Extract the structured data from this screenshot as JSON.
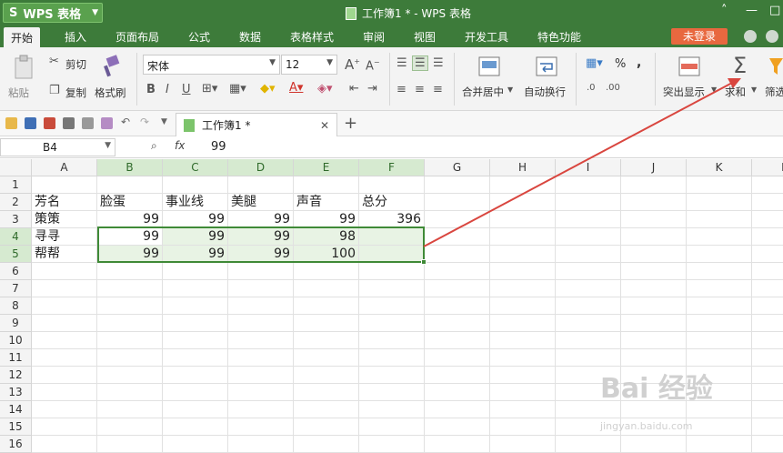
{
  "app": {
    "name": "WPS 表格",
    "logo": "S",
    "doc_title": "工作簿1 * - WPS 表格"
  },
  "menu": {
    "tabs": [
      "开始",
      "插入",
      "页面布局",
      "公式",
      "数据",
      "表格样式",
      "审阅",
      "视图",
      "开发工具",
      "特色功能"
    ],
    "login": "未登录"
  },
  "ribbon": {
    "paste": "粘贴",
    "cut": "剪切",
    "copy": "复制",
    "format_painter": "格式刷",
    "font_name": "宋体",
    "font_size": "12",
    "merge_center": "合并居中",
    "wrap_text": "自动换行",
    "highlight": "突出显示",
    "sum": "求和",
    "filter": "筛选",
    "percent": "%",
    "comma": ","
  },
  "tabbar": {
    "doc_tab": "工作簿1 *"
  },
  "formula_bar": {
    "cell_ref": "B4",
    "fx": "fx",
    "value": "99"
  },
  "columns": [
    "A",
    "B",
    "C",
    "D",
    "E",
    "F",
    "G",
    "H",
    "I",
    "J",
    "K",
    "L"
  ],
  "rows": [
    "1",
    "2",
    "3",
    "4",
    "5",
    "6",
    "7",
    "8",
    "9",
    "10",
    "11",
    "12",
    "13",
    "14",
    "15",
    "16"
  ],
  "cells": {
    "A2": "芳名",
    "B2": "脸蛋",
    "C2": "事业线",
    "D2": "美腿",
    "E2": "声音",
    "F2": "总分",
    "A3": "策策",
    "B3": "99",
    "C3": "99",
    "D3": "99",
    "E3": "99",
    "F3": "396",
    "A4": "寻寻",
    "B4": "99",
    "C4": "99",
    "D4": "99",
    "E4": "98",
    "A5": "帮帮",
    "B5": "99",
    "C5": "99",
    "D5": "99",
    "E5": "100"
  },
  "watermark": {
    "main": "Bai 经验",
    "sub": "jingyan.baidu.com"
  },
  "colors": {
    "accent_green": "#3d7b3a",
    "selection": "#3f8a37",
    "login": "#e8683f",
    "arrow": "#d9463f"
  }
}
